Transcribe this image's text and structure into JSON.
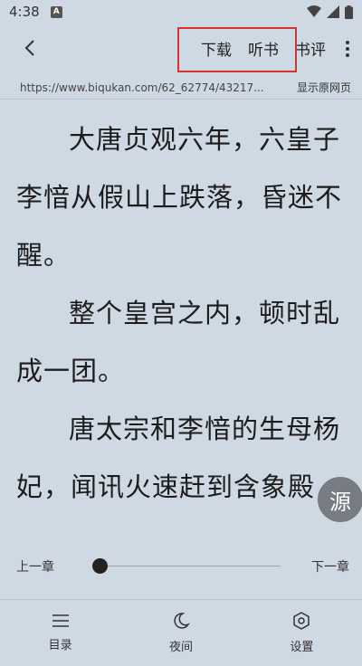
{
  "status_bar": {
    "time": "4:38",
    "notif_letter": "A"
  },
  "toolbar": {
    "download_label": "下载",
    "listen_label": "听书",
    "review_label": "书评"
  },
  "url_bar": {
    "url": "https://www.biqukan.com/62_62774/43217...",
    "show_original_label": "显示原网页"
  },
  "content": {
    "paragraphs": [
      "大唐贞观六年，六皇子李愔从假山上跌落，昏迷不醒。",
      "整个皇宫之内，顿时乱成一团。",
      "唐太宗和李愔的生母杨妃，闻讯火速赶到含象殿"
    ]
  },
  "source_button": {
    "label": "源"
  },
  "chapter_nav": {
    "prev_label": "上一章",
    "next_label": "下一章",
    "progress": 0
  },
  "bottom_nav": {
    "items": [
      {
        "label": "目录",
        "icon": "menu-icon"
      },
      {
        "label": "夜间",
        "icon": "moon-icon"
      },
      {
        "label": "设置",
        "icon": "settings-icon"
      }
    ]
  }
}
